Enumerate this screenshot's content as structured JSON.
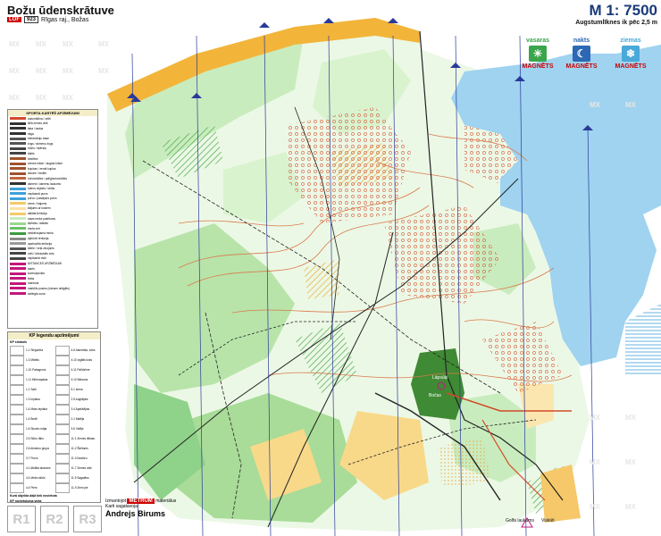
{
  "title": "Božu ūdenskrātuve",
  "subtitle": {
    "badge": "LOF",
    "number": "923",
    "region": "Rīgas raj., Božas"
  },
  "scale": "M 1: 7500",
  "scale_note": "Augstumlīknes ik pēc 2,5 m",
  "sponsors": [
    {
      "season": "vasaras",
      "brand": "MAGNĒTS",
      "color": "#3aa54a",
      "icon_name": "sun-icon"
    },
    {
      "season": "nakts",
      "brand": "MAGNĒTS",
      "color": "#2d68b4",
      "icon_name": "moon-icon"
    },
    {
      "season": "ziemas",
      "brand": "MAGNĒTS",
      "color": "#49a9d8",
      "icon_name": "snowflake-icon"
    }
  ],
  "legend": {
    "title": "SPORTA KARTĒŠ APZĪMĒJUMI",
    "items": [
      {
        "label": "automāšīna / celiš",
        "color": "#d34a2a"
      },
      {
        "label": "lielā zemes celš",
        "color": "#333333"
      },
      {
        "label": "taka / taciņa",
        "color": "#333333"
      },
      {
        "label": "stiga",
        "color": "#333333"
      },
      {
        "label": "elektroliniju trase",
        "color": "#555555"
      },
      {
        "label": "žogs / akmeņu žogs",
        "color": "#555555"
      },
      {
        "label": "mūris / šķēršļa",
        "color": "#444444"
      },
      {
        "label": "kārtis",
        "color": "#444444"
      },
      {
        "label": "bedētes",
        "color": "#a0522d"
      },
      {
        "label": "zemes krāce / augsta krāce",
        "color": "#a0522d"
      },
      {
        "label": "kupicas / zemā kupica",
        "color": "#a0522d"
      },
      {
        "label": "iedobe / bedīte",
        "color": "#a0522d"
      },
      {
        "label": "horizontāles / palīghorizontāles",
        "color": "#c1653a"
      },
      {
        "label": "akmeņi / akmeņu laukums",
        "color": "#333333"
      },
      {
        "label": "ūdens objekts / strūts",
        "color": "#3fa0d8"
      },
      {
        "label": "nepišamā purvs",
        "color": "#3fa0d8"
      },
      {
        "label": "purvs / paslāpiņš purvs",
        "color": "#3fa0d8"
      },
      {
        "label": "zeme / klajums",
        "color": "#f6c86a"
      },
      {
        "label": "klājums ar kokiem",
        "color": "#fbe1a3"
      },
      {
        "label": "atklāta teritorija",
        "color": "#f6c86a"
      },
      {
        "label": "mazs meža pakritums",
        "color": "#c6ecc0"
      },
      {
        "label": "šķērslis / atklāta",
        "color": "#9ad88d"
      },
      {
        "label": "meža ceri",
        "color": "#6cc067"
      },
      {
        "label": "nešķērsojama meža",
        "color": "#3c9a3c"
      },
      {
        "label": "apbūvei teritorija",
        "color": "#8a8a8a"
      },
      {
        "label": "apsbuvēta teritorija",
        "color": "#999999"
      },
      {
        "label": "ābele / ceļa ziņojums",
        "color": "#555555"
      },
      {
        "label": "ceļš / izbrauktās ceļs",
        "color": "#444444"
      },
      {
        "label": "nepišamā mūri",
        "color": "#444444"
      },
      {
        "label": "DISTANCES APZĪMĒJUMI",
        "color": "#c2187a"
      },
      {
        "label": "starts",
        "color": "#c2187a"
      },
      {
        "label": "kontrolpunkts",
        "color": "#c2187a"
      },
      {
        "label": "finišs",
        "color": "#c2187a"
      },
      {
        "label": "maršruts",
        "color": "#c2187a"
      },
      {
        "label": "marķēts posms (vienam obligāts)",
        "color": "#c2187a"
      },
      {
        "label": "aizliegta zona",
        "color": "#c2187a"
      }
    ]
  },
  "kp_legend": {
    "title": "KP legendu apzīmējumi",
    "section1": "KP simbols",
    "items": [
      {
        "label": "1.1 Siegoreta"
      },
      {
        "label": "4.6 Atsevišķs, koks"
      },
      {
        "label": "1.3 Māršts"
      },
      {
        "label": "4.10 Izgālis koks"
      },
      {
        "label": "1.10 Pašagrons"
      },
      {
        "label": "4.11 Palīdzīme"
      },
      {
        "label": "1.11 Mūrmapalas"
      },
      {
        "label": "4.10 Beisona"
      },
      {
        "label": "1.1 Saiti"
      },
      {
        "label": "5.1 žema"
      },
      {
        "label": "1.3 Ieplaka"
      },
      {
        "label": "2.5 Augšējais"
      },
      {
        "label": "1.4 Mazs ieplaka"
      },
      {
        "label": "3.4 Apakšējais"
      },
      {
        "label": "1.4 Bedē"
      },
      {
        "label": "2.1 Malēja"
      },
      {
        "label": "1.6 Skudru māja"
      },
      {
        "label": "3.6 Vidējs"
      },
      {
        "label": "2.5 Stūru tālrs"
      },
      {
        "label": "11.1 Zemes tiltiņas"
      },
      {
        "label": "2.6 Akmeņu grupa"
      },
      {
        "label": "11.2 Šķētums"
      },
      {
        "label": "3.7 Purvs"
      },
      {
        "label": "11.3 Nostūru"
      },
      {
        "label": "4.1 Atklāta laukums"
      },
      {
        "label": "11.7 Zemes ceļš"
      },
      {
        "label": "4.4 Meža stūris"
      },
      {
        "label": "11.9 Sagatāvs"
      },
      {
        "label": "4.4 Piers"
      },
      {
        "label": "11.9 Zemi pie"
      }
    ],
    "section2": "Kurā objekta daļā tiek novietota",
    "section3": "KP novietojuma vieta"
  },
  "result_boxes": [
    "R1",
    "R2",
    "R3"
  ],
  "credits": {
    "line1_prefix": "Izmantojot",
    "brand": "METRUM",
    "line1_suffix": "materiālus",
    "line2": "Karti sagatavoja:",
    "author": "Andrejs Birums"
  },
  "places": {
    "p1": "Lāpsūķi",
    "p2": "Bočas",
    "p3": "Golfa laukums",
    "p4": "Viskūti"
  },
  "colors": {
    "forest_light": "#d8f2cf",
    "forest_mid": "#8fd28a",
    "forest_dark": "#3f8a34",
    "open_yellow": "#f8d98a",
    "lake": "#9fd3f0",
    "path": "#222222",
    "contour": "#d97a4a",
    "map_line_blue": "#2a3a9a"
  }
}
